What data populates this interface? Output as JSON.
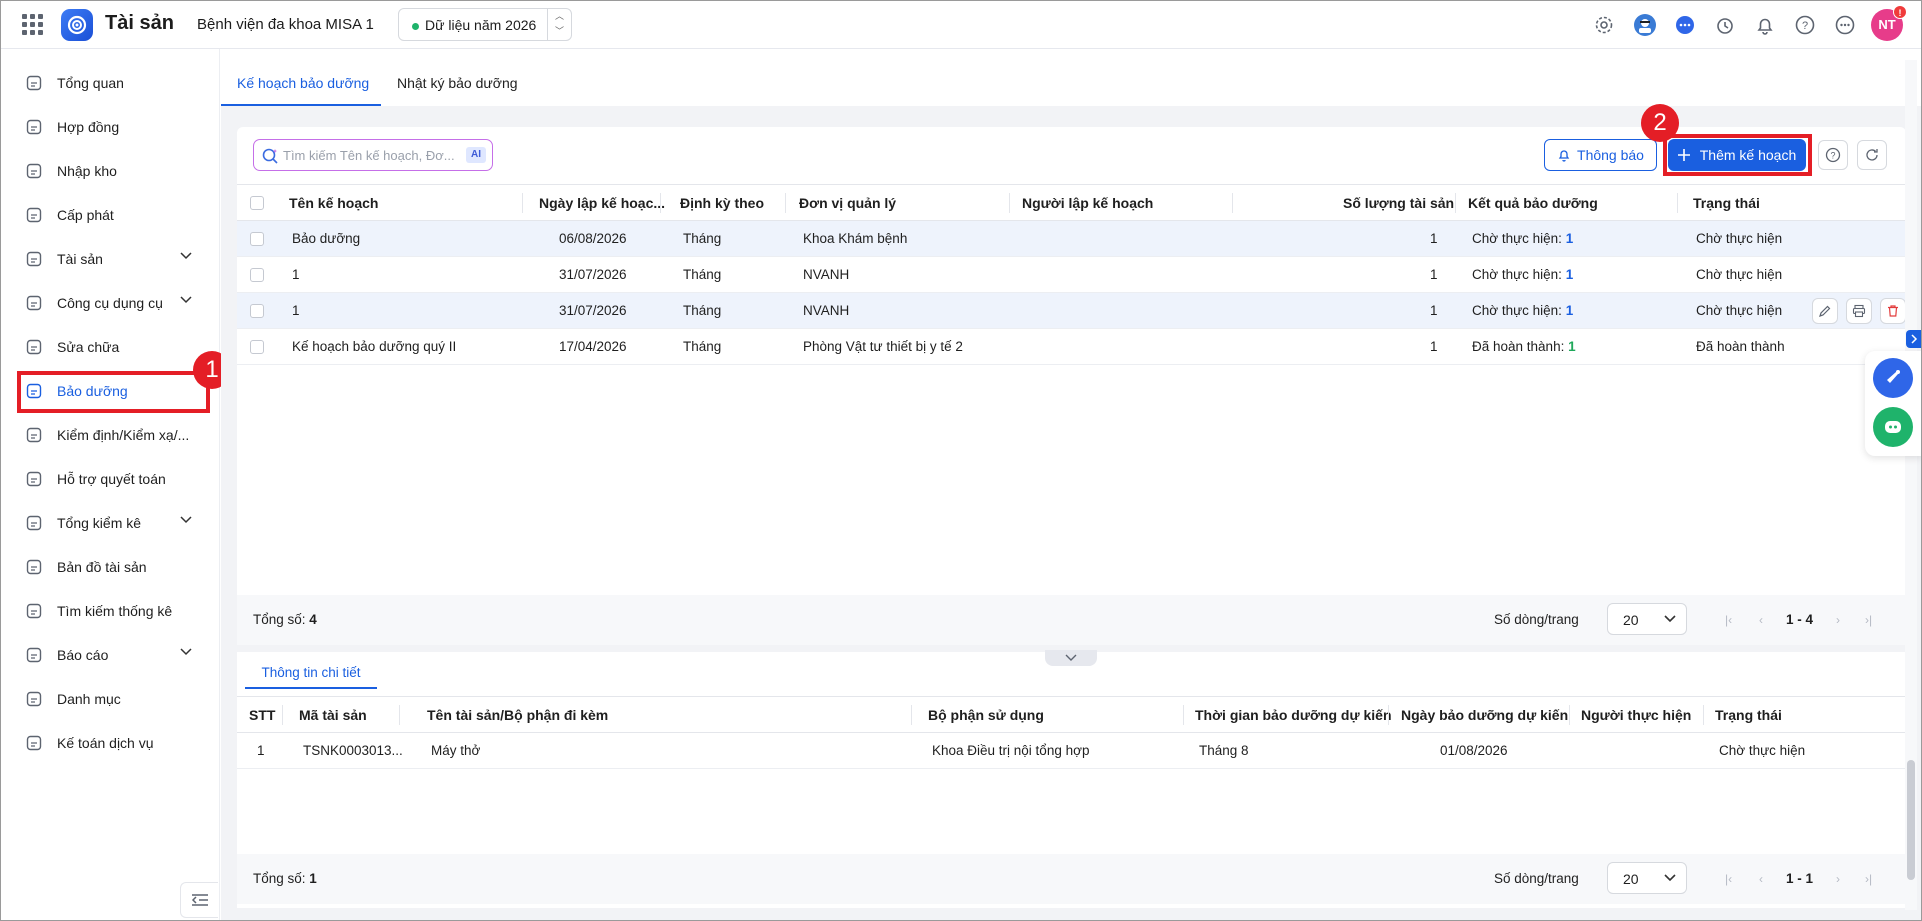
{
  "app": {
    "title": "Tài sản",
    "org": "Bệnh viện đa khoa MISA 1",
    "year": "Dữ liệu năm 2026",
    "avatar": "NT",
    "avatar_badge": "!"
  },
  "sidebar": {
    "items": [
      {
        "label": "Tổng quan",
        "icon": "home-icon"
      },
      {
        "label": "Hợp đồng",
        "icon": "document-icon"
      },
      {
        "label": "Nhập kho",
        "icon": "warehouse-icon"
      },
      {
        "label": "Cấp phát",
        "icon": "distribution-icon"
      },
      {
        "label": "Tài sản",
        "icon": "assets-icon",
        "expandable": true
      },
      {
        "label": "Công cụ dụng cụ",
        "icon": "tools-icon",
        "expandable": true
      },
      {
        "label": "Sửa chữa",
        "icon": "wrench-icon"
      },
      {
        "label": "Bảo dưỡng",
        "icon": "maintenance-icon",
        "active": true
      },
      {
        "label": "Kiểm định/Kiểm xạ/...",
        "icon": "shield-icon"
      },
      {
        "label": "Hỗ trợ quyết toán",
        "icon": "settlement-icon"
      },
      {
        "label": "Tổng kiểm kê",
        "icon": "clipboard-icon",
        "expandable": true
      },
      {
        "label": "Bản đồ tài sản",
        "icon": "map-icon"
      },
      {
        "label": "Tìm kiếm thống kê",
        "icon": "search-doc-icon"
      },
      {
        "label": "Báo cáo",
        "icon": "report-icon",
        "expandable": true
      },
      {
        "label": "Danh mục",
        "icon": "grid-icon"
      },
      {
        "label": "Kế toán dịch vụ",
        "icon": "accounting-icon"
      }
    ]
  },
  "annotations": {
    "step1": "1",
    "step2": "2"
  },
  "tabs": [
    "Kế hoạch bảo dưỡng",
    "Nhật ký bảo dưỡng"
  ],
  "toolbar": {
    "search_placeholder": "Tìm kiếm Tên kế hoạch, Đơ...",
    "ai_badge": "AI",
    "notify": "Thông báo",
    "add": "Thêm kế hoạch"
  },
  "plan_table": {
    "headers": [
      "Tên kế hoạch",
      "Ngày lập kế hoạc...",
      "Định kỳ theo",
      "Đơn vị quản lý",
      "Người lập kế hoạch",
      "Số lượng tài sản",
      "Kết quả bảo dưỡng",
      "Trạng thái"
    ],
    "rows": [
      {
        "name": "Bảo dưỡng",
        "date": "06/08/2026",
        "period": "Tháng",
        "unit": "Khoa Khám bệnh",
        "creator": "",
        "qty": "1",
        "result": "Chờ thực hiện:",
        "result_count": "1",
        "status": "Chờ thực hiện"
      },
      {
        "name": "1",
        "date": "31/07/2026",
        "period": "Tháng",
        "unit": "NVANH",
        "creator": "",
        "qty": "1",
        "result": "Chờ thực hiện:",
        "result_count": "1",
        "status": "Chờ thực hiện"
      },
      {
        "name": "1",
        "date": "31/07/2026",
        "period": "Tháng",
        "unit": "NVANH",
        "creator": "",
        "qty": "1",
        "result": "Chờ thực hiện:",
        "result_count": "1",
        "status": "Chờ thực hiện"
      },
      {
        "name": "Kế hoạch bảo dưỡng quý II",
        "date": "17/04/2026",
        "period": "Tháng",
        "unit": "Phòng Vật tư thiết bị y tế 2",
        "creator": "",
        "qty": "1",
        "result": "Đã hoàn thành:",
        "result_count": "1",
        "status": "Đã hoàn thành"
      }
    ],
    "pager": {
      "total_label": "Tổng số:",
      "total": "4",
      "rows_label": "Số dòng/trang",
      "page_size": "20",
      "range": "1 - 4"
    }
  },
  "detail": {
    "tab": "Thông tin chi tiết",
    "headers": [
      "STT",
      "Mã tài sản",
      "Tên tài sản/Bộ phận đi kèm",
      "Bộ phận sử dụng",
      "Thời gian bảo dưỡng dự kiến",
      "Ngày bảo dưỡng dự kiến",
      "Người thực hiện",
      "Trạng thái"
    ],
    "rows": [
      {
        "stt": "1",
        "code": "TSNK0003013...",
        "name": "Máy thở",
        "dept": "Khoa Điều trị nội tổng hợp",
        "time": "Tháng 8",
        "date": "01/08/2026",
        "performer": "",
        "status": "Chờ thực hiện"
      }
    ],
    "pager": {
      "total_label": "Tổng số:",
      "total": "1",
      "rows_label": "Số dòng/trang",
      "page_size": "20",
      "range": "1 - 1"
    }
  },
  "colors": {
    "accent": "#1a5fe0",
    "highlight": "#e41e26",
    "success": "#1fa85a",
    "avatar": "#e73c8a"
  }
}
